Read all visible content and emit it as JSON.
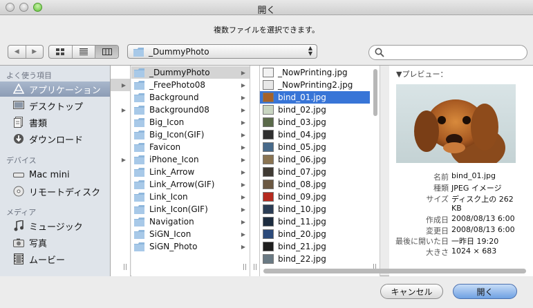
{
  "window": {
    "title": "開く"
  },
  "prompt": "複数ファイルを選択できます。",
  "toolbar": {
    "back_icon": "back-arrow",
    "forward_icon": "forward-arrow",
    "location": "_DummyPhoto",
    "search_placeholder": ""
  },
  "sidebar": {
    "sections": [
      {
        "heading": "よく使う項目",
        "items": [
          {
            "label": "アプリケーション",
            "icon": "applications-icon",
            "selected": true
          },
          {
            "label": "デスクトップ",
            "icon": "desktop-icon"
          },
          {
            "label": "書類",
            "icon": "documents-icon"
          },
          {
            "label": "ダウンロード",
            "icon": "downloads-icon"
          }
        ]
      },
      {
        "heading": "デバイス",
        "items": [
          {
            "label": "Mac mini",
            "icon": "computer-icon"
          },
          {
            "label": "リモートディスク",
            "icon": "disc-icon"
          }
        ]
      },
      {
        "heading": "メディア",
        "items": [
          {
            "label": "ミュージック",
            "icon": "music-icon"
          },
          {
            "label": "写真",
            "icon": "camera-icon"
          },
          {
            "label": "ムービー",
            "icon": "film-icon"
          }
        ]
      }
    ]
  },
  "folders": [
    {
      "name": "_DummyPhoto",
      "selected": true
    },
    {
      "name": "_FreePhoto08"
    },
    {
      "name": "Background"
    },
    {
      "name": "Background08"
    },
    {
      "name": "Big_Icon"
    },
    {
      "name": "Big_Icon(GIF)"
    },
    {
      "name": "Favicon"
    },
    {
      "name": "iPhone_Icon"
    },
    {
      "name": "Link_Arrow"
    },
    {
      "name": "Link_Arrow(GIF)"
    },
    {
      "name": "Link_Icon"
    },
    {
      "name": "Link_Icon(GIF)"
    },
    {
      "name": "Navigation"
    },
    {
      "name": "SiGN_Icon"
    },
    {
      "name": "SiGN_Photo"
    }
  ],
  "files": [
    {
      "name": "_NowPrinting.jpg",
      "color": "#f2f2f2"
    },
    {
      "name": "_NowPrinting2.jpg",
      "color": "#e8e8e8"
    },
    {
      "name": "bind_01.jpg",
      "color": "#a5622a",
      "selected": true
    },
    {
      "name": "bind_02.jpg",
      "color": "#c9d6c2"
    },
    {
      "name": "bind_03.jpg",
      "color": "#5a6a4a"
    },
    {
      "name": "bind_04.jpg",
      "color": "#2f2f2f"
    },
    {
      "name": "bind_05.jpg",
      "color": "#486a8a"
    },
    {
      "name": "bind_06.jpg",
      "color": "#8a7452"
    },
    {
      "name": "bind_07.jpg",
      "color": "#3f3a33"
    },
    {
      "name": "bind_08.jpg",
      "color": "#6b5842"
    },
    {
      "name": "bind_09.jpg",
      "color": "#b52a1f"
    },
    {
      "name": "bind_10.jpg",
      "color": "#2b3d55"
    },
    {
      "name": "bind_11.jpg",
      "color": "#1d2c3f"
    },
    {
      "name": "bind_20.jpg",
      "color": "#2c4a7a"
    },
    {
      "name": "bind_21.jpg",
      "color": "#1e1e1e"
    },
    {
      "name": "bind_22.jpg",
      "color": "#6a7a84"
    }
  ],
  "preview": {
    "heading": "▼プレビュー：",
    "meta": [
      {
        "key": "名前",
        "value": "bind_01.jpg"
      },
      {
        "key": "種類",
        "value": "JPEG イメージ"
      },
      {
        "key": "サイズ",
        "value": "ディスク上の 262"
      },
      {
        "key": "",
        "value": "KB"
      },
      {
        "key": "作成日",
        "value": "2008/08/13 6:00"
      },
      {
        "key": "変更日",
        "value": "2008/08/13 6:00"
      },
      {
        "key": "最後に開いた日",
        "value": "一昨日 19:20"
      },
      {
        "key": "大きさ",
        "value": "1024 × 683"
      }
    ]
  },
  "buttons": {
    "cancel": "キャンセル",
    "open": "開く"
  }
}
